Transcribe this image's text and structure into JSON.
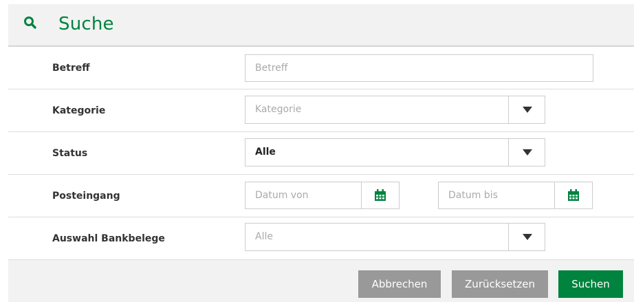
{
  "header": {
    "title": "Suche",
    "icon": "search-icon"
  },
  "form": {
    "betreff": {
      "label": "Betreff",
      "placeholder": "Betreff"
    },
    "kategorie": {
      "label": "Kategorie",
      "placeholder": "Kategorie"
    },
    "status": {
      "label": "Status",
      "value": "Alle"
    },
    "posteingang": {
      "label": "Posteingang",
      "from_placeholder": "Datum von",
      "to_placeholder": "Datum bis"
    },
    "bankbelege": {
      "label": "Auswahl Bankbelege",
      "placeholder": "Alle"
    }
  },
  "buttons": {
    "cancel": "Abbrechen",
    "reset": "Zurücksetzen",
    "search": "Suchen"
  },
  "colors": {
    "accent": "#00833e",
    "button_grey": "#999999",
    "header_bg": "#f2f2f2"
  }
}
